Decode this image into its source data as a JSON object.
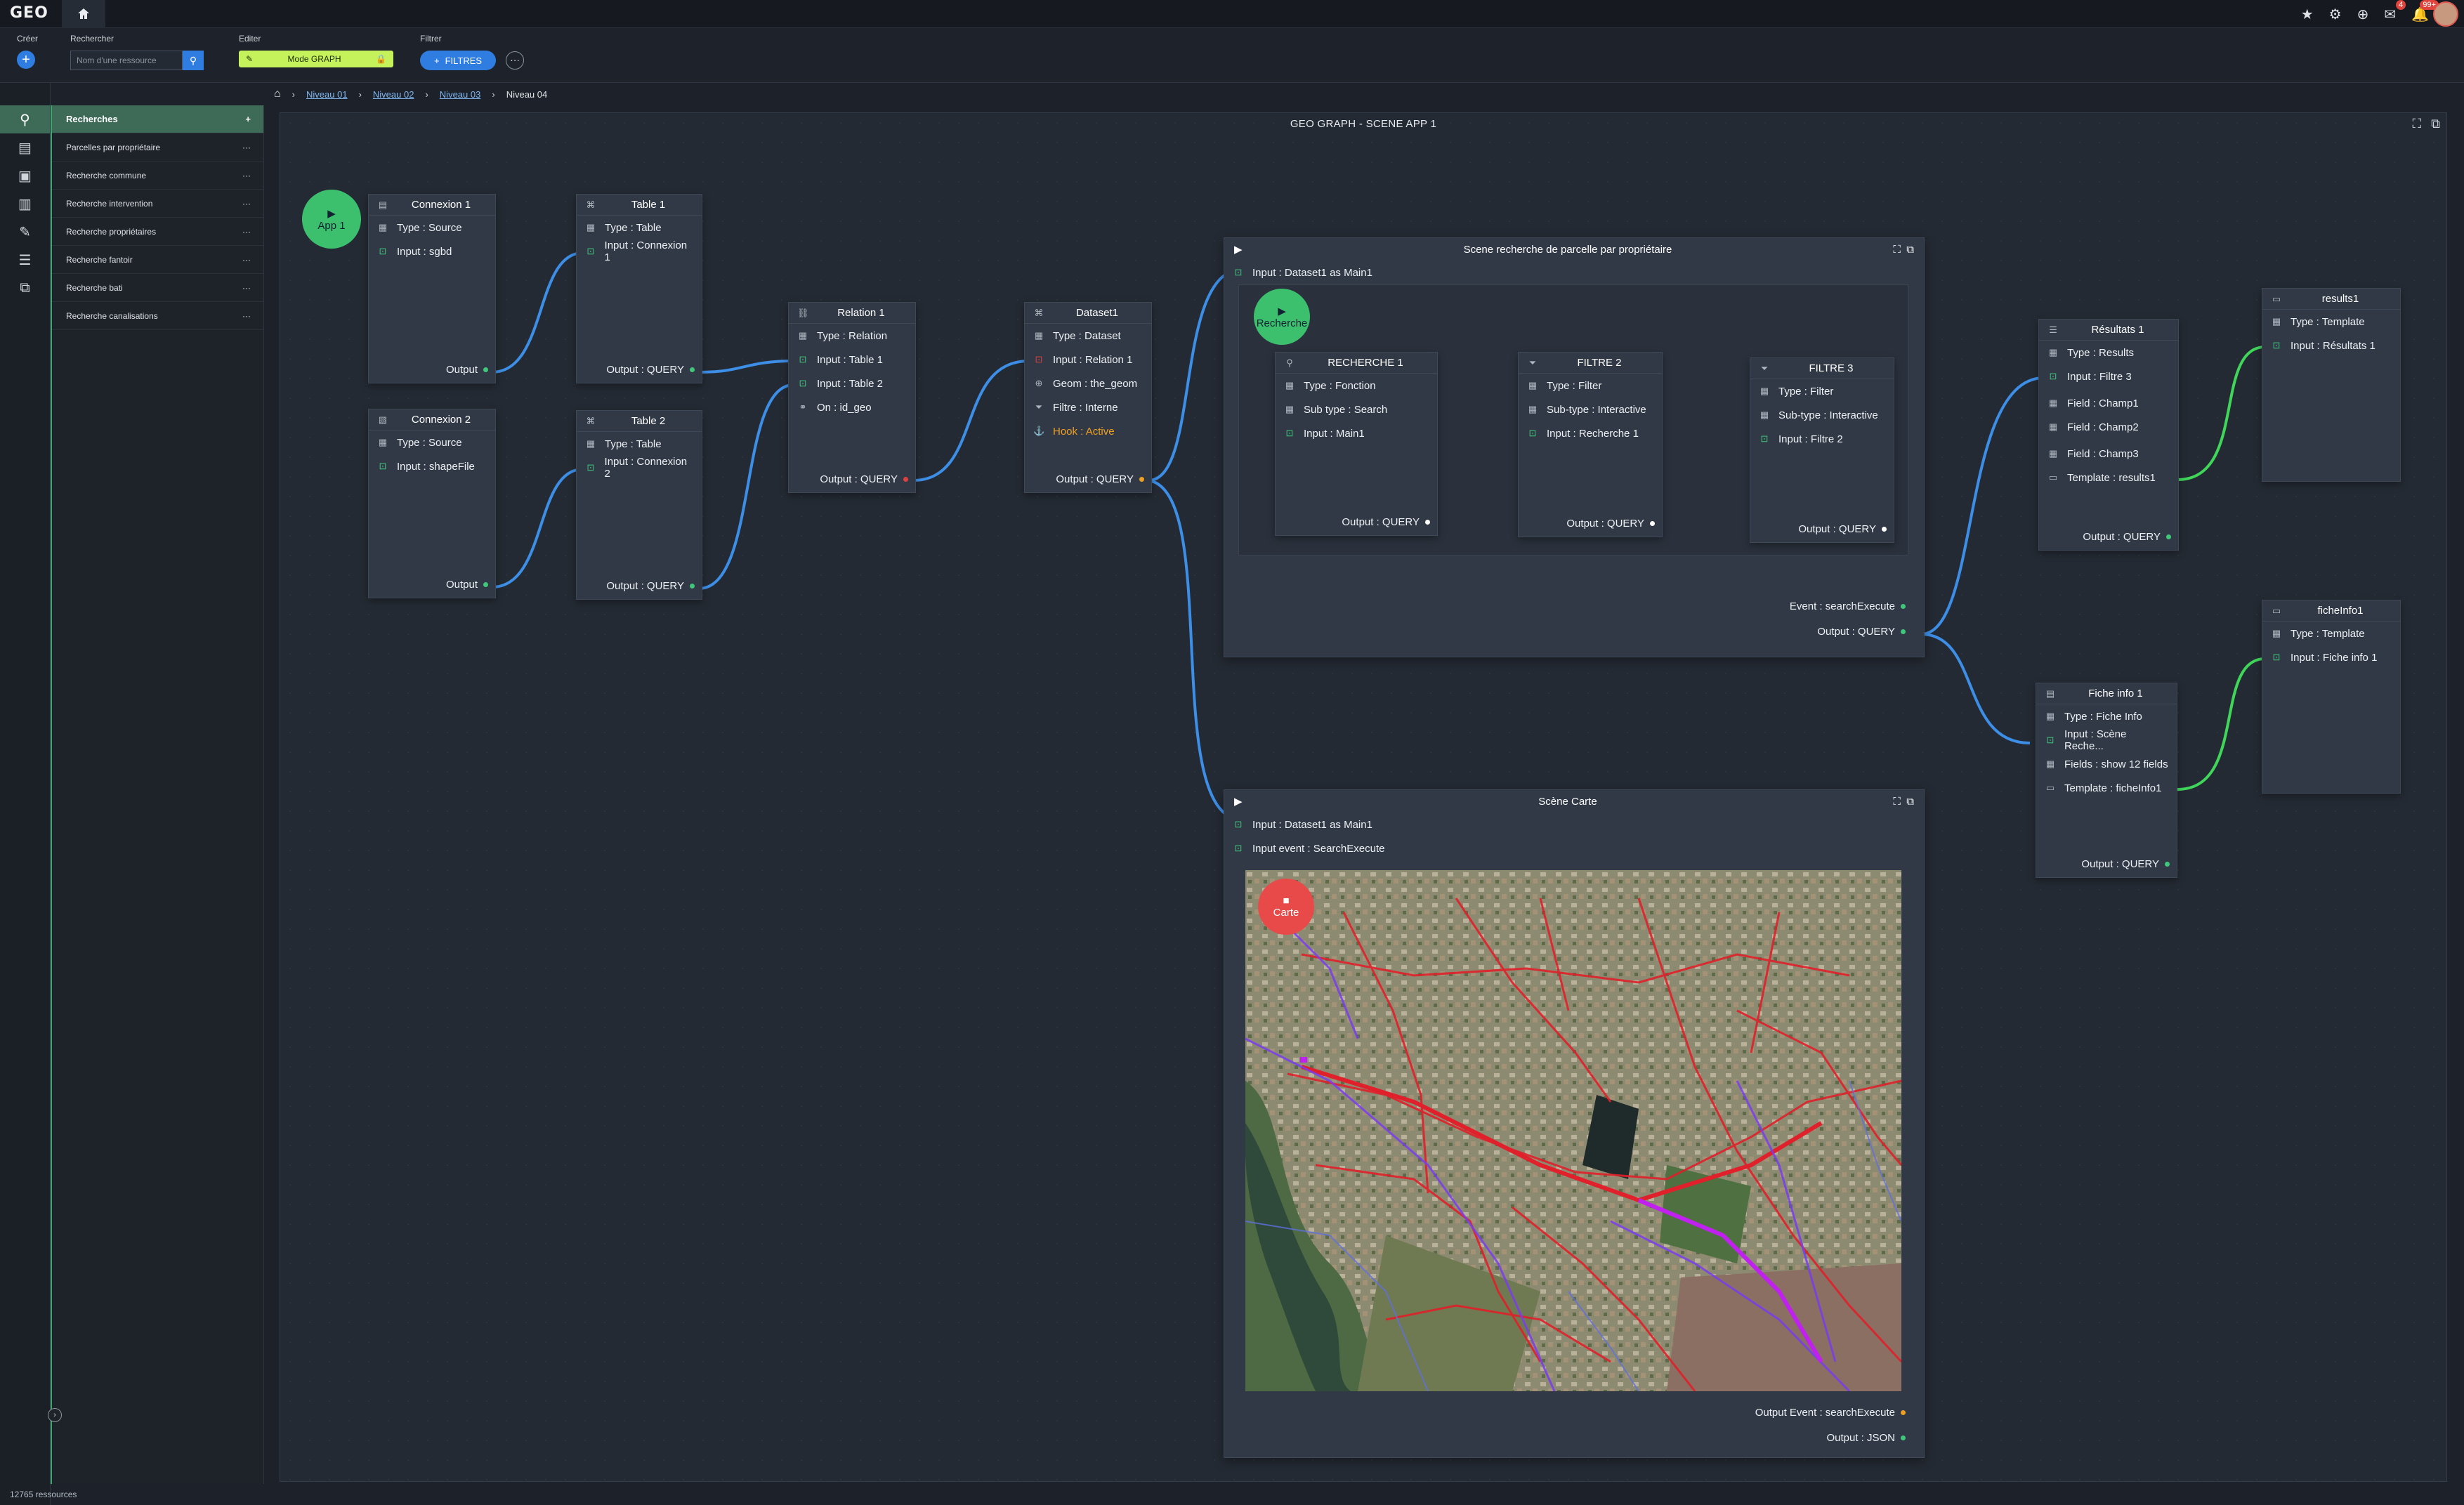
{
  "app": {
    "logo": "GEO",
    "badge_messages": "4",
    "badge_notifications": "99+"
  },
  "toolbar": {
    "create_label": "Créer",
    "search_label": "Rechercher",
    "search_placeholder": "Nom d'une ressource",
    "edit_label": "Editer",
    "mode_label": "Mode GRAPH",
    "filter_label": "Filtrer",
    "filters_button": "FILTRES"
  },
  "sidebar": {
    "items": [
      {
        "label": "Recherches"
      },
      {
        "label": "Parcelles par propriétaire"
      },
      {
        "label": "Recherche commune"
      },
      {
        "label": "Recherche intervention"
      },
      {
        "label": "Recherche propriétaires"
      },
      {
        "label": "Recherche fantoir"
      },
      {
        "label": "Recherche bati"
      },
      {
        "label": "Recherche canalisations"
      }
    ],
    "status": "12765 ressources"
  },
  "breadcrumb": {
    "l1": "Niveau 01",
    "l2": "Niveau 02",
    "l3": "Niveau 03",
    "current": "Niveau 04"
  },
  "canvas": {
    "title": "GEO GRAPH - SCENE APP 1"
  },
  "nodes": {
    "app": "App 1",
    "connexion1": {
      "title": "Connexion 1",
      "type": "Type : Source",
      "input": "Input : sgbd",
      "output": "Output"
    },
    "connexion2": {
      "title": "Connexion 2",
      "type": "Type : Source",
      "input": "Input : shapeFile",
      "output": "Output"
    },
    "table1": {
      "title": "Table 1",
      "type": "Type : Table",
      "input": "Input : Connexion 1",
      "output": "Output : QUERY"
    },
    "table2": {
      "title": "Table 2",
      "type": "Type : Table",
      "input": "Input : Connexion 2",
      "output": "Output : QUERY"
    },
    "relation1": {
      "title": "Relation 1",
      "type": "Type : Relation",
      "input1": "Input : Table 1",
      "input2": "Input : Table 2",
      "on": "On :  id_geo",
      "output": "Output : QUERY"
    },
    "dataset1": {
      "title": "Dataset1",
      "type": "Type : Dataset",
      "input": "Input : Relation 1",
      "geom": "Geom : the_geom",
      "filtre": "Filtre : Interne",
      "hook": "Hook : Active",
      "output": "Output : QUERY"
    },
    "resultats1": {
      "title": "Résultats 1",
      "type": "Type : Results",
      "input": "Input : Filtre 3",
      "f1": "Field : Champ1",
      "f2": "Field : Champ2",
      "f3": "Field : Champ3",
      "template": "Template : results1",
      "output": "Output : QUERY"
    },
    "results1": {
      "title": "results1",
      "type": "Type : Template",
      "input": "Input : Résultats 1"
    },
    "ficheinfo1": {
      "title": "Fiche info 1",
      "type": "Type : Fiche Info",
      "input": "Input : Scène Reche...",
      "fields": "Fields : show 12 fields",
      "template": "Template : ficheInfo1",
      "output": "Output : QUERY"
    },
    "ficheInfoTpl": {
      "title": "ficheInfo1",
      "type": "Type : Template",
      "input": "Input : Fiche info 1"
    }
  },
  "scene_search": {
    "title": "Scene recherche de parcelle par propriétaire",
    "input": "Input : Dataset1 as Main1",
    "start": "Recherche",
    "recherche1": {
      "title": "RECHERCHE 1",
      "type": "Type : Fonction",
      "subtype": "Sub type : Search",
      "input": "Input : Main1",
      "output": "Output : QUERY"
    },
    "filtre2": {
      "title": "FILTRE 2",
      "type": "Type : Filter",
      "subtype": "Sub-type : Interactive",
      "input": "Input : Recherche 1",
      "output": "Output : QUERY"
    },
    "filtre3": {
      "title": "FILTRE  3",
      "type": "Type : Filter",
      "subtype": "Sub-type : Interactive",
      "input": "Input : Filtre 2",
      "output": "Output : QUERY"
    },
    "event": "Event : searchExecute",
    "output": "Output : QUERY"
  },
  "scene_map": {
    "title": "Scène Carte",
    "input": "Input : Dataset1 as Main1",
    "input_event": "Input event : SearchExecute",
    "map_label": "Carte",
    "output_event": "Output Event : searchExecute",
    "output": "Output : JSON"
  },
  "colors": {
    "accent": "#2f7de1",
    "green": "#3cc06e",
    "wire_blue": "#3d8ee6",
    "wire_green": "#3fd65a",
    "hook": "#f0a020",
    "map_button": "#e84a4a"
  }
}
